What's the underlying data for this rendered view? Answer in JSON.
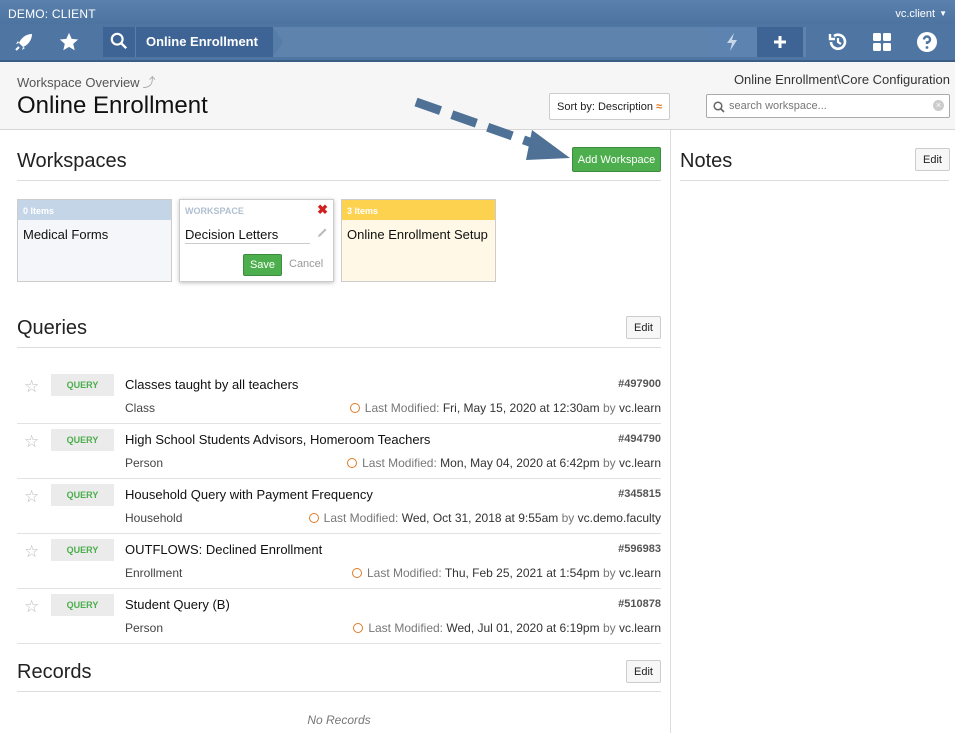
{
  "topbar": {
    "client_name": "DEMO: CLIENT",
    "user": "vc.client",
    "breadcrumb": "Online Enrollment"
  },
  "header": {
    "crumb": "Workspace Overview",
    "title": "Online Enrollment",
    "path": "Online Enrollment\\Core Configuration",
    "sort_label": "Sort by: Description",
    "search_placeholder": "search workspace..."
  },
  "workspaces": {
    "title": "Workspaces",
    "add_label": "Add Workspace",
    "cards": [
      {
        "count": "0 Items",
        "name": "Medical Forms"
      },
      {
        "count": "3 Items",
        "name": "Online Enrollment Setup"
      }
    ],
    "editor": {
      "label": "WORKSPACE",
      "value": "Decision Letters",
      "save": "Save",
      "cancel": "Cancel"
    }
  },
  "notes": {
    "title": "Notes",
    "edit": "Edit"
  },
  "queries": {
    "title": "Queries",
    "edit": "Edit",
    "modified_prefix": "Last Modified:",
    "by": "by",
    "items": [
      {
        "badge": "QUERY",
        "title": "Classes taught by all teachers",
        "type": "Class",
        "id": "#497900",
        "date": "Fri, May 15, 2020 at 12:30am",
        "user": "vc.learn"
      },
      {
        "badge": "QUERY",
        "title": "High School Students Advisors, Homeroom Teachers",
        "type": "Person",
        "id": "#494790",
        "date": "Mon, May 04, 2020 at 6:42pm",
        "user": "vc.learn"
      },
      {
        "badge": "QUERY",
        "title": "Household Query with Payment Frequency",
        "type": "Household",
        "id": "#345815",
        "date": "Wed, Oct 31, 2018 at 9:55am",
        "user": "vc.demo.faculty"
      },
      {
        "badge": "QUERY",
        "title": "OUTFLOWS: Declined Enrollment",
        "type": "Enrollment",
        "id": "#596983",
        "date": "Thu, Feb 25, 2021 at 1:54pm",
        "user": "vc.learn"
      },
      {
        "badge": "QUERY",
        "title": "Student Query (B)",
        "type": "Person",
        "id": "#510878",
        "date": "Wed, Jul 01, 2020 at 6:19pm",
        "user": "vc.learn"
      }
    ]
  },
  "records": {
    "title": "Records",
    "edit": "Edit",
    "empty": "No Records"
  },
  "colors": {
    "topbar": "#4f76a2",
    "accent_green": "#4cae4c",
    "clock_orange": "#e07b26"
  }
}
